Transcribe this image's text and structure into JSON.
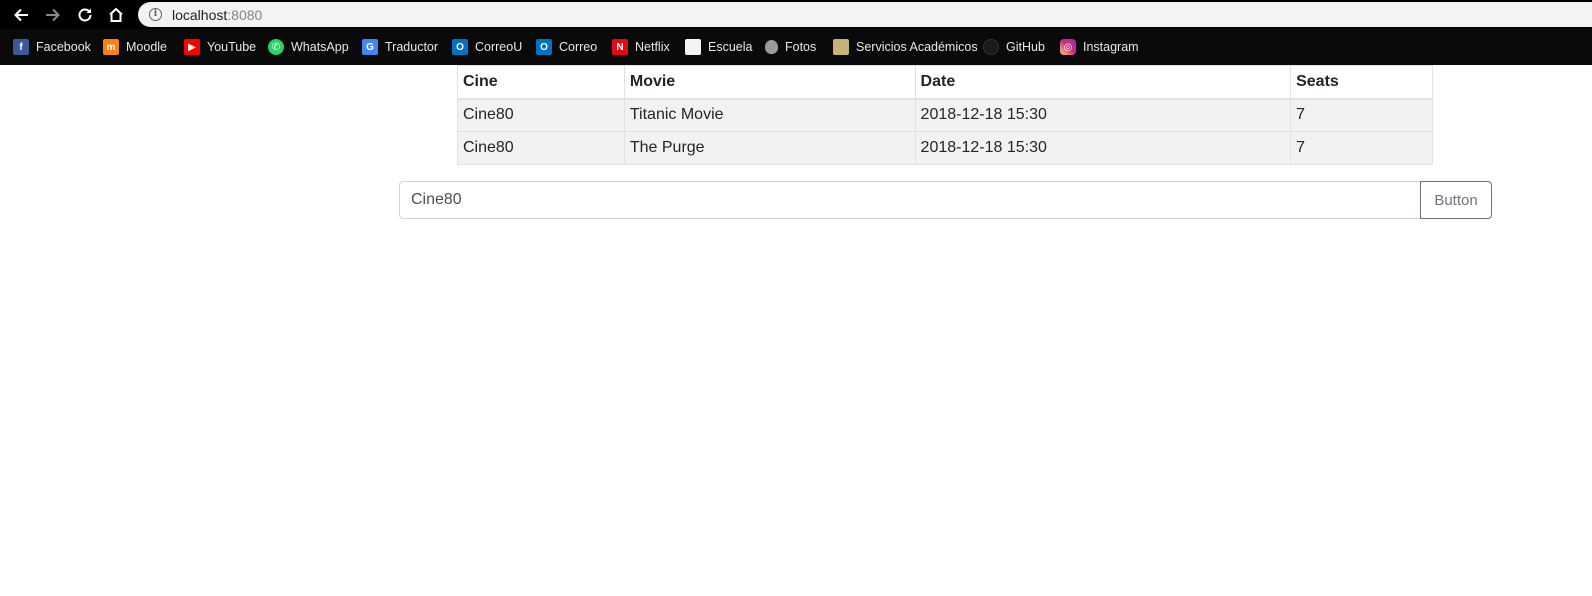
{
  "browser": {
    "url_host": "localhost",
    "url_port": ":8080"
  },
  "bookmarks": [
    {
      "label": "Facebook",
      "icon": "facebook-icon",
      "color": "#3b5998",
      "glyph": "f"
    },
    {
      "label": "Moodle",
      "icon": "moodle-icon",
      "color": "#f98012",
      "glyph": "m"
    },
    {
      "label": "YouTube",
      "icon": "youtube-icon",
      "color": "#ff0000",
      "glyph": "▶"
    },
    {
      "label": "WhatsApp",
      "icon": "whatsapp-icon",
      "color": "#25d366",
      "glyph": "✆"
    },
    {
      "label": "Traductor",
      "icon": "translate-icon",
      "color": "#4285f4",
      "glyph": "G"
    },
    {
      "label": "CorreoU",
      "icon": "outlook-icon",
      "color": "#0072c6",
      "glyph": "O"
    },
    {
      "label": "Correo",
      "icon": "outlook-icon",
      "color": "#0072c6",
      "glyph": "O"
    },
    {
      "label": "Netflix",
      "icon": "netflix-icon",
      "color": "#e50914",
      "glyph": "N"
    },
    {
      "label": "Escuela",
      "icon": "document-icon",
      "color": "#e8e8e8",
      "glyph": ""
    },
    {
      "label": "Fotos",
      "icon": "apple-icon",
      "color": "#9a9a9a",
      "glyph": ""
    },
    {
      "label": "Servicios Académicos",
      "icon": "academic-services-icon",
      "color": "#c8b27a",
      "glyph": ""
    },
    {
      "label": "GitHub",
      "icon": "github-icon",
      "color": "#1b1b1b",
      "glyph": ""
    },
    {
      "label": "Instagram",
      "icon": "instagram-icon",
      "color": "#c13584",
      "glyph": "◎"
    }
  ],
  "table": {
    "headers": [
      "Cine",
      "Movie",
      "Date",
      "Seats"
    ],
    "rows": [
      [
        "Cine80",
        "Titanic Movie",
        "2018-12-18 15:30",
        "7"
      ],
      [
        "Cine80",
        "The Purge",
        "2018-12-18 15:30",
        "7"
      ]
    ]
  },
  "form": {
    "input_value": "Cine80",
    "button_label": "Button"
  }
}
